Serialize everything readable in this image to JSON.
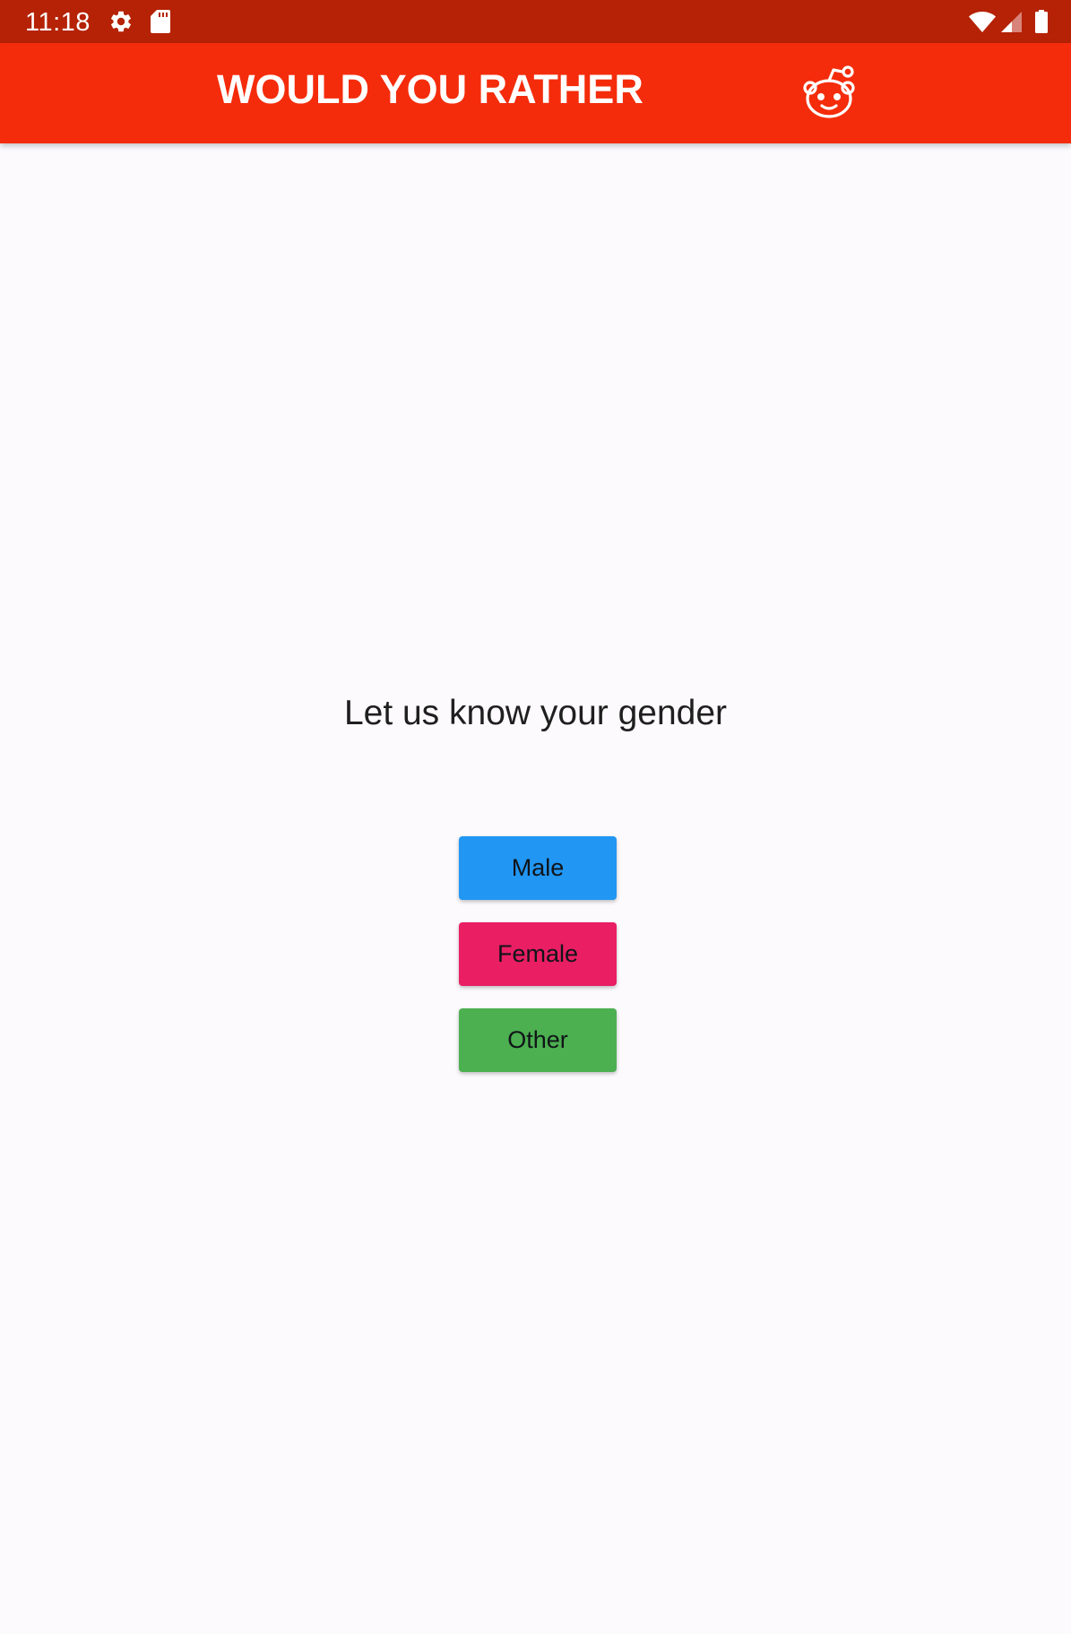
{
  "status_bar": {
    "time": "11:18",
    "left_icons": [
      "settings-icon",
      "sd-card-icon"
    ],
    "right_icons": [
      "wifi-icon",
      "cell-signal-icon",
      "battery-icon"
    ],
    "background": "#b52205"
  },
  "app_bar": {
    "title": "WOULD YOU RATHER",
    "logo_icon": "reddit-icon",
    "background": "#f42c0b"
  },
  "main": {
    "prompt": "Let us know your gender",
    "buttons": [
      {
        "label": "Male",
        "color": "#2196f3"
      },
      {
        "label": "Female",
        "color": "#e91e63"
      },
      {
        "label": "Other",
        "color": "#4caf50"
      }
    ]
  },
  "colors": {
    "page_background": "#fcfafc",
    "text": "#1f1f1f"
  }
}
